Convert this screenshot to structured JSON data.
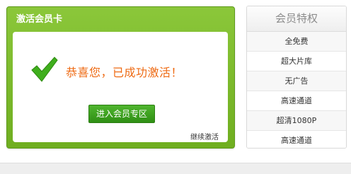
{
  "card": {
    "title": "激活会员卡",
    "success_message": "恭喜您，已成功激活！",
    "enter_button": "进入会员专区",
    "continue_link": "继续激活",
    "accent_green": "#7ab82c",
    "message_color": "#ee6a13"
  },
  "privileges": {
    "title": "会员特权",
    "items": [
      {
        "label": "全免费"
      },
      {
        "label": "超大片库"
      },
      {
        "label": "无广告"
      },
      {
        "label": "高速通道"
      },
      {
        "label": "超清1080P"
      },
      {
        "label": "高速通道"
      }
    ]
  }
}
